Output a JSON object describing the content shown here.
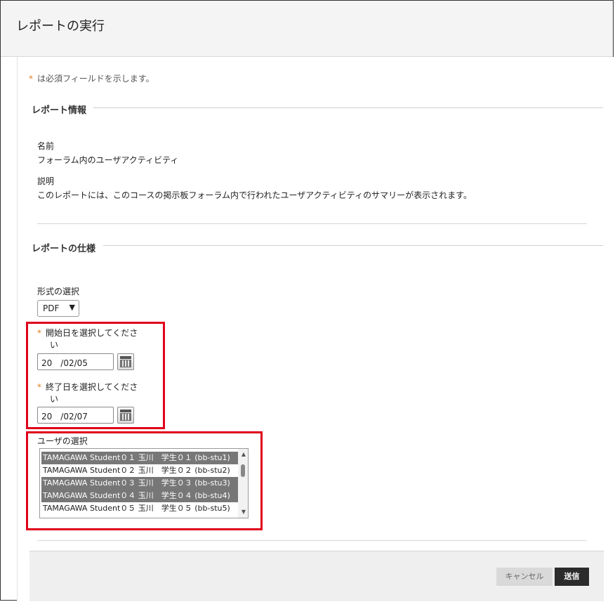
{
  "page": {
    "title": "レポートの実行"
  },
  "required_note": {
    "star": "*",
    "text": "は必須フィールドを示します。"
  },
  "report_info": {
    "section_title": "レポート情報",
    "name_label": "名前",
    "name_value": "フォーラム内のユーザアクティビティ",
    "desc_label": "説明",
    "desc_value": "このレポートには、このコースの掲示板フォーラム内で行われたユーザアクティビティのサマリーが表示されます。"
  },
  "report_spec": {
    "section_title": "レポートの仕様",
    "format_label": "形式の選択",
    "format_value": "PDF",
    "start_label_line1": "開始日を選択してくださ",
    "start_label_line2": "い",
    "start_value": "20　/02/05",
    "end_label_line1": "終了日を選択してくださ",
    "end_label_line2": "い",
    "end_value": "20　/02/07",
    "user_label": "ユーザの選択",
    "users": [
      {
        "label": "TAMAGAWA Student０１ 玉川　学生０１ (bb-stu1)",
        "selected": true
      },
      {
        "label": "TAMAGAWA Student０２ 玉川　学生０２ (bb-stu2)",
        "selected": false
      },
      {
        "label": "TAMAGAWA Student０３ 玉川　学生０３ (bb-stu3)",
        "selected": true
      },
      {
        "label": "TAMAGAWA Student０４ 玉川　学生０４ (bb-stu4)",
        "selected": true
      },
      {
        "label": "TAMAGAWA Student０５ 玉川　学生０５ (bb-stu5)",
        "selected": false
      }
    ]
  },
  "footer": {
    "cancel_label": "キャンセル",
    "submit_label": "送信"
  },
  "colors": {
    "required_star": "#e0801c",
    "highlight": "#e0001b",
    "submit_bg": "#2b2b2b"
  }
}
